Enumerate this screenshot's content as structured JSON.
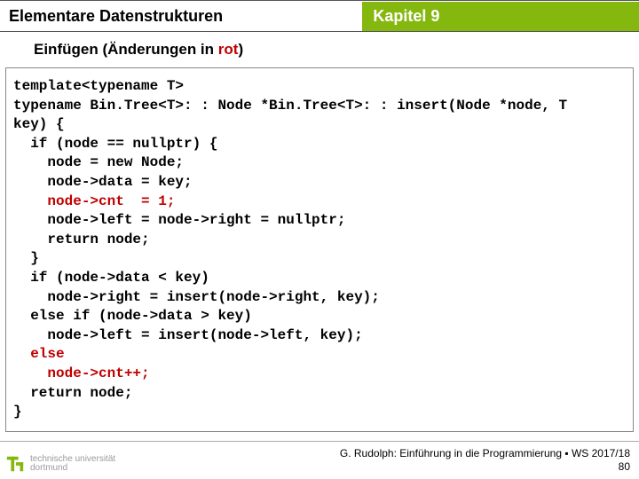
{
  "header": {
    "left": "Elementare Datenstrukturen",
    "right": "Kapitel 9"
  },
  "subhead": {
    "prefix": "Einfügen (Änderungen in ",
    "highlight": "rot",
    "suffix": ")"
  },
  "code": {
    "l01": "template<typename T>",
    "l02": "typename Bin.Tree<T>: : Node *Bin.Tree<T>: : insert(Node *node, T",
    "l03": "key) {",
    "l04": "  if (node == nullptr) {",
    "l05": "    node = new Node;",
    "l06": "    node->data = key;",
    "l07a": "    ",
    "l07b": "node->cnt  = 1;",
    "l08": "    node->left = node->right = nullptr;",
    "l09": "    return node;",
    "l10": "  }",
    "l11": "  if (node->data < key)",
    "l12": "    node->right = insert(node->right, key);",
    "l13": "  else if (node->data > key)",
    "l14": "    node->left = insert(node->left, key);",
    "l15a": "  ",
    "l15b": "else",
    "l16a": "    ",
    "l16b": "node->cnt++;",
    "l17": "  return node;",
    "l18": "}"
  },
  "footer": {
    "uni1": "technische universität",
    "uni2": "dortmund",
    "credit1": "G. Rudolph: Einführung in die Programmierung ▪ WS 2017/18",
    "credit2": "80"
  }
}
